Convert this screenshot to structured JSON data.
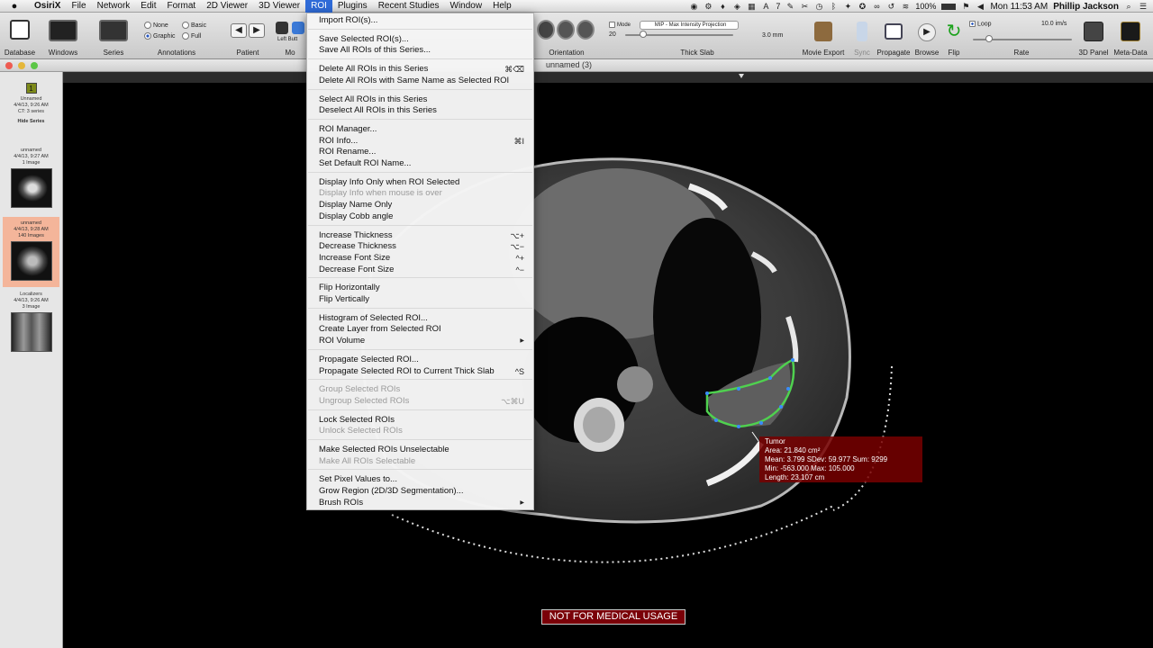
{
  "menubar": {
    "apple": "",
    "items": [
      "OsiriX",
      "File",
      "Network",
      "Edit",
      "Format",
      "2D Viewer",
      "3D Viewer",
      "ROI",
      "Plugins",
      "Recent Studies",
      "Window",
      "Help"
    ],
    "battery": "100%",
    "clock": "Mon 11:53 AM",
    "user": "Phillip Jackson",
    "status_badge": "7"
  },
  "toolbar": {
    "labels": {
      "database": "Database",
      "windows": "Windows",
      "series": "Series",
      "annotations": "Annotations",
      "patient": "Patient",
      "mouse": "Mo",
      "orientation": "Orientation",
      "thick_slab": "Thick Slab",
      "movie_export": "Movie Export",
      "sync": "Sync",
      "propagate": "Propagate",
      "browse": "Browse",
      "flip": "Flip",
      "rate": "Rate",
      "panel_3d": "3D Panel",
      "metadata": "Meta-Data"
    },
    "annotation_options": [
      "None",
      "Basic",
      "Graphic",
      "Full"
    ],
    "annotation_selected": "Graphic",
    "left_button": "Left Butt",
    "mode_label": "Mode",
    "mode_value": "MIP - Max Intensity Projection",
    "slab_count": "20",
    "slab_thickness": "3.0 mm",
    "loop_label": "Loop",
    "rate_value": "10.0 im/s"
  },
  "window": {
    "title": "unnamed (3)"
  },
  "sidebar": {
    "header": {
      "badge": "1",
      "lines": [
        "Unnamed",
        "4/4/13, 9:26 AM",
        "CT: 3 series"
      ],
      "hide": "Hide Series"
    },
    "series": [
      {
        "lines": [
          "unnamed",
          "4/4/13, 9:27 AM",
          "1 Image"
        ],
        "selected": false
      },
      {
        "lines": [
          "unnamed",
          "4/4/13, 9:28 AM",
          "140 Images"
        ],
        "selected": true
      },
      {
        "lines": [
          "Localizers",
          "4/4/13, 9:26 AM",
          "3 Image"
        ],
        "selected": false
      }
    ]
  },
  "roi_menu": {
    "items": [
      {
        "label": "Import ROI(s)...",
        "shortcut": "",
        "disabled": false
      },
      {
        "sep": true
      },
      {
        "label": "Save Selected ROI(s)...",
        "shortcut": "",
        "disabled": false
      },
      {
        "label": "Save All ROIs of this Series...",
        "shortcut": "",
        "disabled": false
      },
      {
        "sep": true
      },
      {
        "label": "Delete All ROIs in this Series",
        "shortcut": "⌘⌫",
        "disabled": false
      },
      {
        "label": "Delete All ROIs with Same Name as Selected ROI",
        "shortcut": "",
        "disabled": false
      },
      {
        "sep": true
      },
      {
        "label": "Select All ROIs in this Series",
        "shortcut": "",
        "disabled": false
      },
      {
        "label": "Deselect All ROIs in this Series",
        "shortcut": "",
        "disabled": false
      },
      {
        "sep": true
      },
      {
        "label": "ROI Manager...",
        "shortcut": "",
        "disabled": false
      },
      {
        "label": "ROI Info...",
        "shortcut": "⌘I",
        "disabled": false
      },
      {
        "label": "ROI Rename...",
        "shortcut": "",
        "disabled": false
      },
      {
        "label": "Set Default ROI Name...",
        "shortcut": "",
        "disabled": false
      },
      {
        "sep": true
      },
      {
        "label": "Display Info Only when ROI Selected",
        "shortcut": "",
        "disabled": false
      },
      {
        "label": "Display Info when mouse is over",
        "shortcut": "",
        "disabled": true
      },
      {
        "label": "Display Name Only",
        "shortcut": "",
        "disabled": false
      },
      {
        "label": "Display Cobb angle",
        "shortcut": "",
        "disabled": false
      },
      {
        "sep": true
      },
      {
        "label": "Increase Thickness",
        "shortcut": "⌥+",
        "disabled": false
      },
      {
        "label": "Decrease Thickness",
        "shortcut": "⌥−",
        "disabled": false
      },
      {
        "label": "Increase Font Size",
        "shortcut": "^+",
        "disabled": false
      },
      {
        "label": "Decrease Font Size",
        "shortcut": "^−",
        "disabled": false
      },
      {
        "sep": true
      },
      {
        "label": "Flip Horizontally",
        "shortcut": "",
        "disabled": false
      },
      {
        "label": "Flip Vertically",
        "shortcut": "",
        "disabled": false
      },
      {
        "sep": true
      },
      {
        "label": "Histogram of Selected ROI...",
        "shortcut": "",
        "disabled": false
      },
      {
        "label": "Create Layer from Selected ROI",
        "shortcut": "",
        "disabled": false
      },
      {
        "label": "ROI Volume",
        "shortcut": "▶",
        "disabled": false
      },
      {
        "sep": true
      },
      {
        "label": "Propagate Selected ROI...",
        "shortcut": "",
        "disabled": false
      },
      {
        "label": "Propagate Selected ROI to Current Thick Slab",
        "shortcut": "^S",
        "disabled": false
      },
      {
        "sep": true
      },
      {
        "label": "Group Selected ROIs",
        "shortcut": "",
        "disabled": true
      },
      {
        "label": "Ungroup Selected ROIs",
        "shortcut": "⌥⌘U",
        "disabled": true
      },
      {
        "sep": true
      },
      {
        "label": "Lock Selected ROIs",
        "shortcut": "",
        "disabled": false
      },
      {
        "label": "Unlock Selected ROIs",
        "shortcut": "",
        "disabled": true
      },
      {
        "sep": true
      },
      {
        "label": "Make Selected ROIs Unselectable",
        "shortcut": "",
        "disabled": false
      },
      {
        "label": "Make All ROIs Selectable",
        "shortcut": "",
        "disabled": true
      },
      {
        "sep": true
      },
      {
        "label": "Set Pixel Values to...",
        "shortcut": "",
        "disabled": false
      },
      {
        "label": "Grow Region (2D/3D Segmentation)...",
        "shortcut": "",
        "disabled": false
      },
      {
        "label": "Brush ROIs",
        "shortcut": "▶",
        "disabled": false
      }
    ]
  },
  "roi_info": {
    "name": "Tumor",
    "area": "Area: 21.840 cm²",
    "stats1": "Mean: 3.799   SDev: 59.977   Sum: 9299",
    "stats2": "Min: -563.000   Max: 105.000",
    "length": "Length: 23.107 cm"
  },
  "warning": "NOT FOR MEDICAL USAGE",
  "colors": {
    "menu_highlight": "#2f6bd8",
    "roi_outline": "#4fd14f",
    "roi_point": "#3a8cff",
    "info_bg": "#780000"
  }
}
